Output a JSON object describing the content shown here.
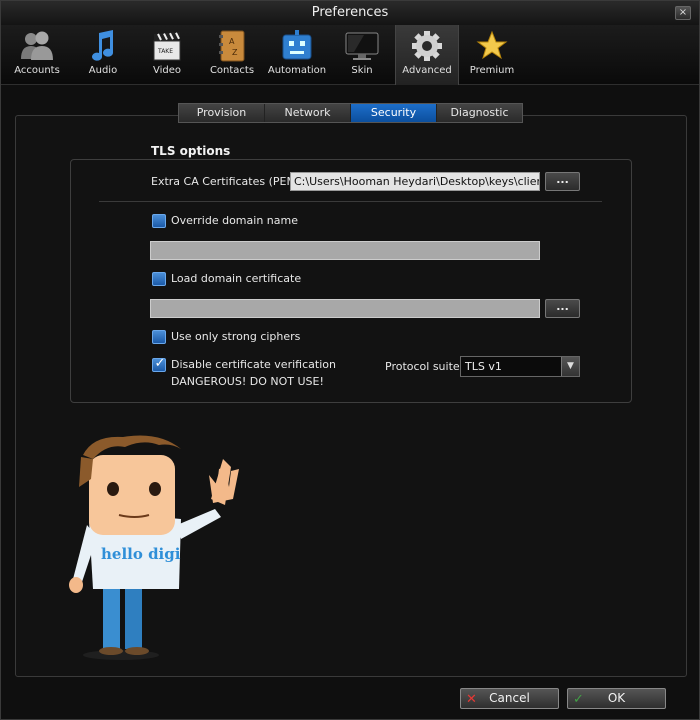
{
  "window": {
    "title": "Preferences",
    "close_symbol": "×"
  },
  "toolbar": {
    "items": [
      {
        "label": "Accounts",
        "icon": "accounts-icon"
      },
      {
        "label": "Audio",
        "icon": "music-note-icon"
      },
      {
        "label": "Video",
        "icon": "clapperboard-icon"
      },
      {
        "label": "Contacts",
        "icon": "address-book-icon"
      },
      {
        "label": "Automation",
        "icon": "robot-icon"
      },
      {
        "label": "Skin",
        "icon": "monitor-icon"
      },
      {
        "label": "Advanced",
        "icon": "gear-icon",
        "active": true
      },
      {
        "label": "Premium",
        "icon": "star-icon"
      }
    ]
  },
  "tabs": [
    {
      "label": "Provision"
    },
    {
      "label": "Network"
    },
    {
      "label": "Security",
      "active": true
    },
    {
      "label": "Diagnostic"
    }
  ],
  "tls": {
    "title": "TLS options",
    "ca_label": "Extra CA Certificates (PEM)",
    "ca_value": "C:\\Users\\Hooman Heydari\\Desktop\\keys\\client.pem",
    "browse_label": "...",
    "override_domain": {
      "label": "Override domain name",
      "checked": false,
      "value": ""
    },
    "load_cert": {
      "label": "Load domain certificate",
      "checked": false,
      "value": ""
    },
    "strong_ciphers": {
      "label": "Use only strong ciphers",
      "checked": false
    },
    "disable_verify": {
      "label_line1": "Disable certificate verification",
      "label_line2": "DANGEROUS! DO NOT USE!",
      "checked": true
    },
    "protocol_label": "Protocol suite:",
    "protocol_value": "TLS v1"
  },
  "mascot": {
    "shirt_text": "hello digi"
  },
  "buttons": {
    "cancel": {
      "label": "Cancel",
      "icon": "✕"
    },
    "ok": {
      "label": "OK",
      "icon": "✓"
    }
  },
  "colors": {
    "accent": "#1565c0",
    "checkbox": "#2f74c4",
    "cancel_icon": "#e53935",
    "ok_icon": "#43a047"
  }
}
